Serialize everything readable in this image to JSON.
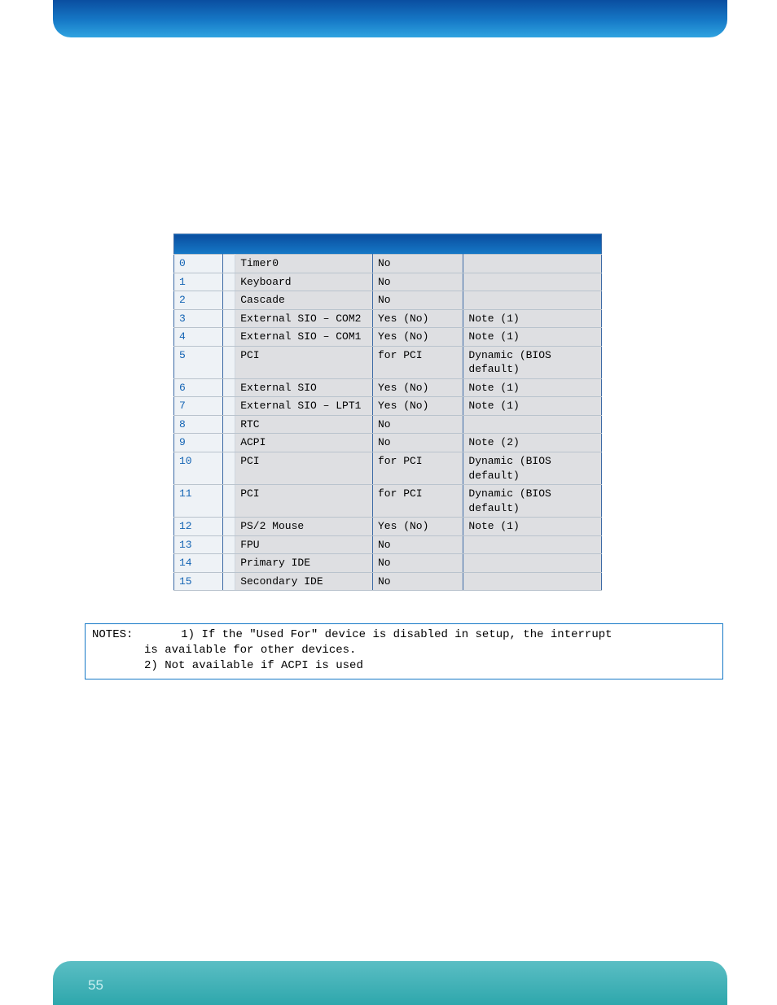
{
  "rows": [
    {
      "num": "0",
      "used": "Timer0",
      "avail": "No",
      "comm": ""
    },
    {
      "num": "1",
      "used": "Keyboard",
      "avail": "No",
      "comm": ""
    },
    {
      "num": "2",
      "used": "Cascade",
      "avail": "No",
      "comm": ""
    },
    {
      "num": "3",
      "used": "External SIO – COM2",
      "avail": "Yes (No)",
      "comm": "Note (1)"
    },
    {
      "num": "4",
      "used": "External SIO – COM1",
      "avail": "Yes (No)",
      "comm": "Note (1)"
    },
    {
      "num": "5",
      "used": "PCI",
      "avail": "for PCI",
      "comm": "Dynamic (BIOS default)"
    },
    {
      "num": "6",
      "used": "External SIO",
      "avail": "Yes (No)",
      "comm": "Note (1)"
    },
    {
      "num": "7",
      "used": "External SIO – LPT1",
      "avail": "Yes (No)",
      "comm": "Note (1)"
    },
    {
      "num": "8",
      "used": "RTC",
      "avail": "No",
      "comm": ""
    },
    {
      "num": "9",
      "used": "ACPI",
      "avail": "No",
      "comm": "Note (2)"
    },
    {
      "num": "10",
      "used": "PCI",
      "avail": "for PCI",
      "comm": "Dynamic (BIOS default)"
    },
    {
      "num": "11",
      "used": "PCI",
      "avail": "for PCI",
      "comm": "Dynamic (BIOS default)"
    },
    {
      "num": "12",
      "used": "PS/2 Mouse",
      "avail": "Yes (No)",
      "comm": "Note (1)"
    },
    {
      "num": "13",
      "used": "FPU",
      "avail": "No",
      "comm": ""
    },
    {
      "num": "14",
      "used": "Primary IDE",
      "avail": "No",
      "comm": ""
    },
    {
      "num": "15",
      "used": "Secondary IDE",
      "avail": "No",
      "comm": ""
    }
  ],
  "notes": {
    "label": "NOTES:",
    "line1a": "1) If the \"Used For\" device is disabled in setup, the interrupt",
    "line1b": "is available for other devices.",
    "line2": "2) Not available if ACPI is used"
  },
  "page_number": "55"
}
